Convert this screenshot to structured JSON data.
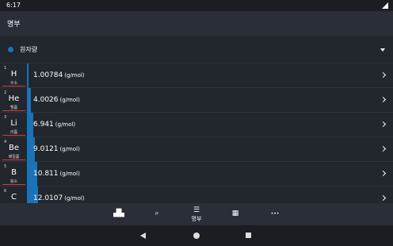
{
  "status": {
    "time": "6:17"
  },
  "app_bar": {
    "title": "명부"
  },
  "sort": {
    "label": "원자량",
    "accent": "#1a73b8"
  },
  "elements": [
    {
      "number": "1",
      "symbol": "H",
      "name": "수소",
      "value": "1.00784",
      "unit": "(g/mol)",
      "ratio": 0.03
    },
    {
      "number": "2",
      "symbol": "He",
      "name": "헬륨",
      "value": "4.0026",
      "unit": "(g/mol)",
      "ratio": 0.23
    },
    {
      "number": "3",
      "symbol": "Li",
      "name": "리튬",
      "value": "6.941",
      "unit": "(g/mol)",
      "ratio": 0.4
    },
    {
      "number": "4",
      "symbol": "Be",
      "name": "베릴륨",
      "value": "9.0121",
      "unit": "(g/mol)",
      "ratio": 0.52
    },
    {
      "number": "5",
      "symbol": "B",
      "name": "붕소",
      "value": "10.811",
      "unit": "(g/mol)",
      "ratio": 0.63
    },
    {
      "number": "6",
      "symbol": "C",
      "name": "탄소",
      "value": "12.0107",
      "unit": "(g/mol)",
      "ratio": 0.7
    }
  ],
  "bottom_nav": [
    {
      "icon": "bar-chart-icon",
      "glyph": "▟▙",
      "label": ""
    },
    {
      "icon": "search-icon",
      "glyph": "⌕",
      "label": ""
    },
    {
      "icon": "list-icon",
      "glyph": "☰",
      "label": "명부"
    },
    {
      "icon": "table-icon",
      "glyph": "▦",
      "label": ""
    },
    {
      "icon": "more-icon",
      "glyph": "•••",
      "label": ""
    }
  ]
}
